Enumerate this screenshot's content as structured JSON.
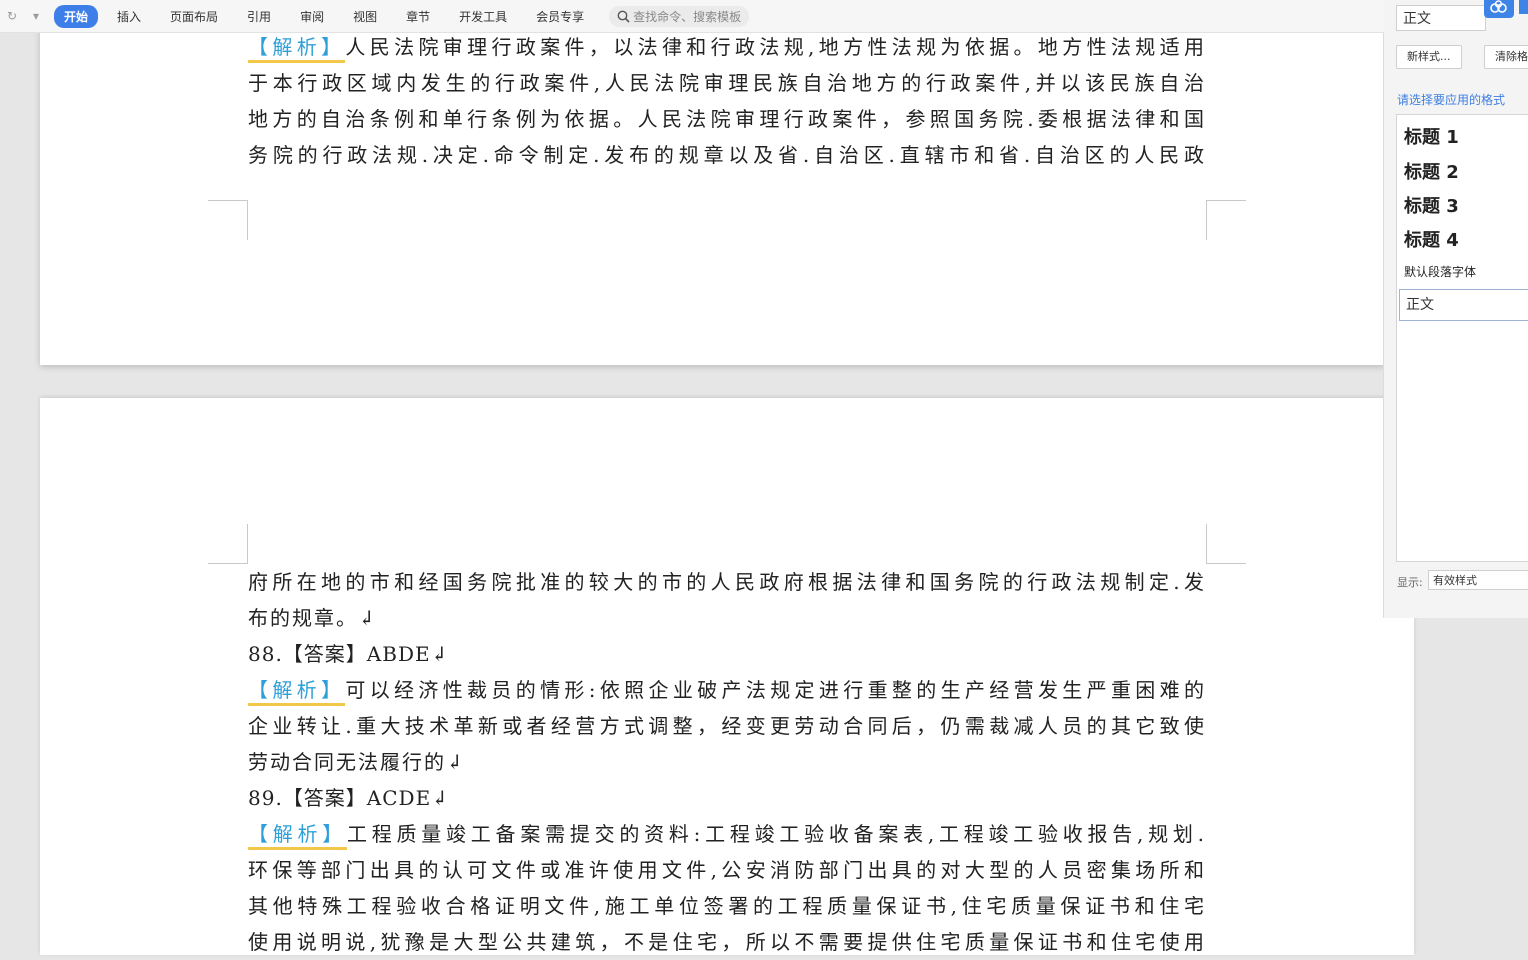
{
  "toolbar": {
    "tabs": [
      "开始",
      "插入",
      "页面布局",
      "引用",
      "审阅",
      "视图",
      "章节",
      "开发工具",
      "会员专享"
    ],
    "search_placeholder": "查找命令、搜索模板"
  },
  "document": {
    "page1_lines": [
      "人民法院审理行政案件，以法律和行政法规,地方性法规为依据。地方性法规适用",
      "于本行政区域内发生的行政案件,人民法院审理民族自治地方的行政案件,并以该民族自治",
      "地方的自治条例和单行条例为依据。人民法院审理行政案件，参照国务院.委根据法律和国",
      "务院的行政法规.决定.命令制定.发布的规章以及省.自治区.直辖市和省.自治区的人民政"
    ],
    "page2": {
      "cont_lines": [
        "府所在地的市和经国务院批准的较大的市的人民政府根据法律和国务院的行政法规制定.发",
        "布的规章。↲"
      ],
      "q88_answer": "88.【答案】ABDE↲",
      "q88_lines": [
        "可以经济性裁员的情形:依照企业破产法规定进行重整的生产经营发生严重困难的",
        "企业转让.重大技术革新或者经营方式调整，经变更劳动合同后，仍需裁减人员的其它致使",
        "劳动合同无法履行的↲"
      ],
      "q89_answer": "89.【答案】ACDE↲",
      "q89_lines": [
        "工程质量竣工备案需提交的资料:工程竣工验收备案表,工程竣工验收报告,规划.",
        "环保等部门出具的认可文件或准许使用文件,公安消防部门出具的对大型的人员密集场所和",
        "其他特殊工程验收合格证明文件,施工单位签署的工程质量保证书,住宅质量保证书和住宅",
        "使用说明说,犹豫是大型公共建筑，不是住宅，所以不需要提供住宅质量保证书和住宅使用"
      ]
    },
    "jiexi_label": "【解析】"
  },
  "styles_panel": {
    "current_style": "正文",
    "new_style_button": "新样式...",
    "clear_button": "清除格",
    "hint": "请选择要应用的格式",
    "styles": [
      "标题 1",
      "标题 2",
      "标题 3",
      "标题 4"
    ],
    "default_font": "默认段落字体",
    "body_style": "正文",
    "show_label": "显示:",
    "show_value": "有效样式"
  },
  "colors": {
    "accent": "#3d7ee9",
    "jiexi": "#2f9fd9",
    "jiexi_underline": "#f2c74a"
  }
}
